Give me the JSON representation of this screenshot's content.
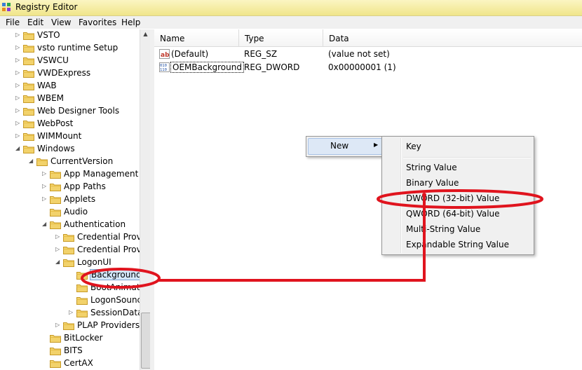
{
  "window": {
    "title": "Registry Editor",
    "icon": "registry-icon"
  },
  "menu": [
    "File",
    "Edit",
    "View",
    "Favorites",
    "Help"
  ],
  "tree": [
    {
      "label": "VSTO",
      "expander": "collapsed"
    },
    {
      "label": "vsto runtime Setup",
      "expander": "collapsed"
    },
    {
      "label": "VSWCU",
      "expander": "collapsed"
    },
    {
      "label": "VWDExpress",
      "expander": "collapsed"
    },
    {
      "label": "WAB",
      "expander": "collapsed"
    },
    {
      "label": "WBEM",
      "expander": "collapsed"
    },
    {
      "label": "Web Designer Tools",
      "expander": "collapsed"
    },
    {
      "label": "WebPost",
      "expander": "collapsed"
    },
    {
      "label": "WIMMount",
      "expander": "collapsed"
    },
    {
      "label": "Windows",
      "expander": "expanded"
    },
    {
      "label": "CurrentVersion",
      "expander": "expanded"
    },
    {
      "label": "App Management",
      "expander": "collapsed"
    },
    {
      "label": "App Paths",
      "expander": "collapsed"
    },
    {
      "label": "Applets",
      "expander": "collapsed"
    },
    {
      "label": "Audio",
      "expander": "none"
    },
    {
      "label": "Authentication",
      "expander": "expanded"
    },
    {
      "label": "Credential Provi",
      "expander": "collapsed"
    },
    {
      "label": "Credential Provi",
      "expander": "collapsed"
    },
    {
      "label": "LogonUI",
      "expander": "expanded"
    },
    {
      "label": "Background",
      "expander": "none",
      "selected": true
    },
    {
      "label": "BootAnimat",
      "expander": "none"
    },
    {
      "label": "LogonSounc",
      "expander": "none"
    },
    {
      "label": "SessionData",
      "expander": "collapsed"
    },
    {
      "label": "PLAP Providers",
      "expander": "collapsed"
    },
    {
      "label": "BitLocker",
      "expander": "none"
    },
    {
      "label": "BITS",
      "expander": "none"
    },
    {
      "label": "CertAX",
      "expander": "none"
    }
  ],
  "columns": {
    "name": "Name",
    "type": "Type",
    "data": "Data"
  },
  "values": [
    {
      "name": "(Default)",
      "type": "REG_SZ",
      "data": "(value not set)",
      "icon": "string-value-icon"
    },
    {
      "name": "OEMBackground",
      "type": "REG_DWORD",
      "data": "0x00000001 (1)",
      "icon": "binary-value-icon"
    }
  ],
  "context_menu": {
    "new_label": "New"
  },
  "new_submenu": [
    "Key",
    "String Value",
    "Binary Value",
    "DWORD (32-bit) Value",
    "QWORD (64-bit) Value",
    "Multi-String Value",
    "Expandable String Value"
  ],
  "annotation_color": "#e0141e",
  "colors": {
    "titlebar": "#f3ebb0",
    "selection": "#d5e8fb",
    "menu_bg": "#f0f0f0"
  }
}
